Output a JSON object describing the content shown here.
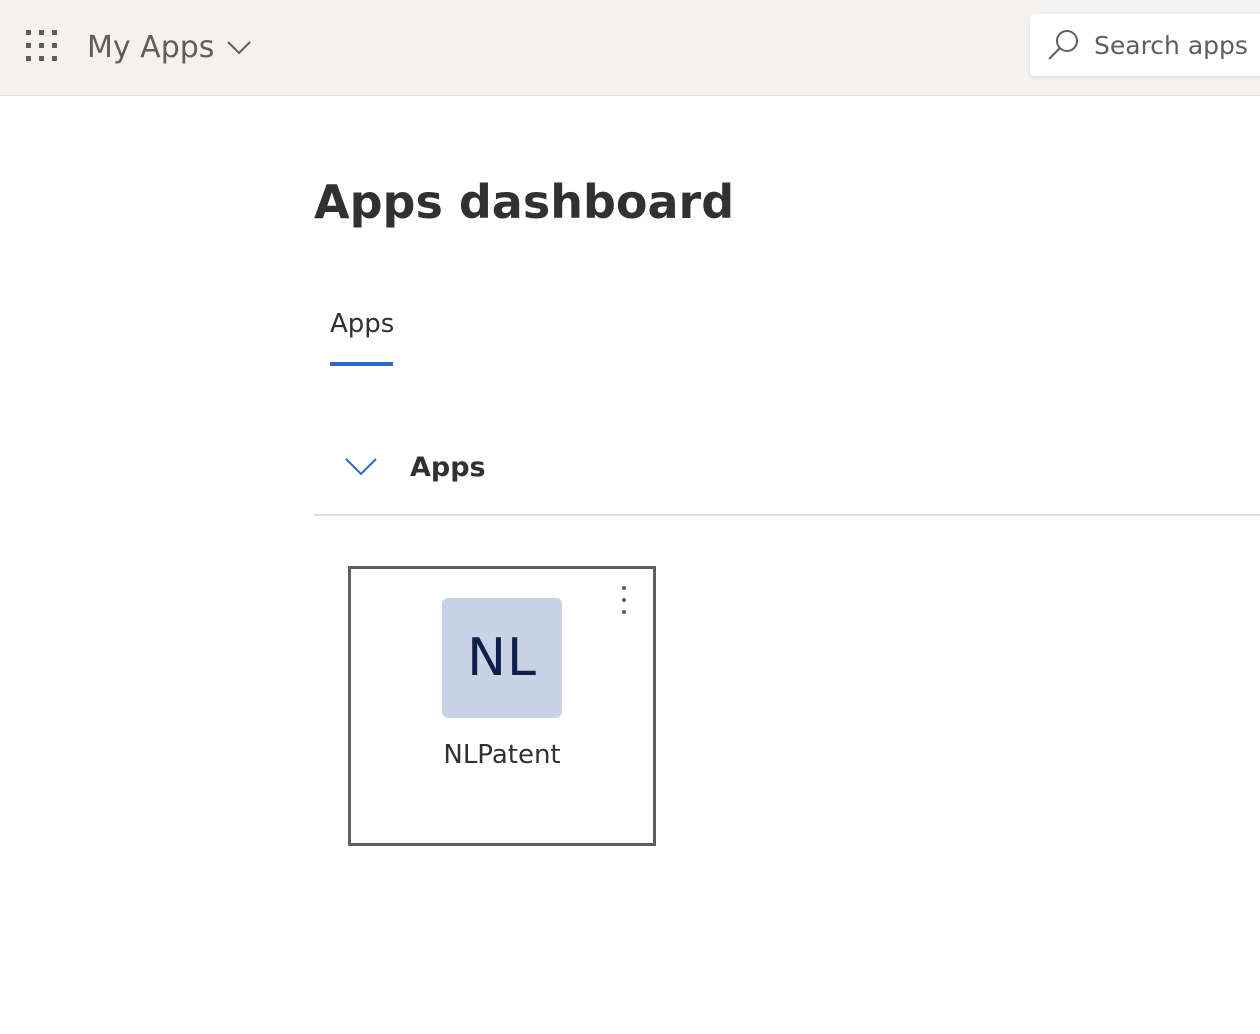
{
  "header": {
    "app_title": "My Apps",
    "search": {
      "placeholder": "Search apps",
      "value": ""
    },
    "icons": {
      "launcher": "waffle-icon",
      "title_chevron": "chevron-down-icon",
      "search": "search-icon"
    }
  },
  "main": {
    "page_title": "Apps dashboard",
    "tabs": [
      {
        "label": "Apps",
        "selected": true
      }
    ],
    "section": {
      "label": "Apps",
      "expanded": true,
      "icon": "chevron-down-icon"
    },
    "apps": [
      {
        "initials": "NL",
        "name": "NLPatent",
        "more_icon": "more-vertical-icon"
      }
    ]
  },
  "colors": {
    "topbar_bg": "#f3f2f1",
    "accent": "#2b6ac6",
    "app_tile_bg": "#c8d4e6",
    "app_tile_text": "#0e1f4c"
  }
}
